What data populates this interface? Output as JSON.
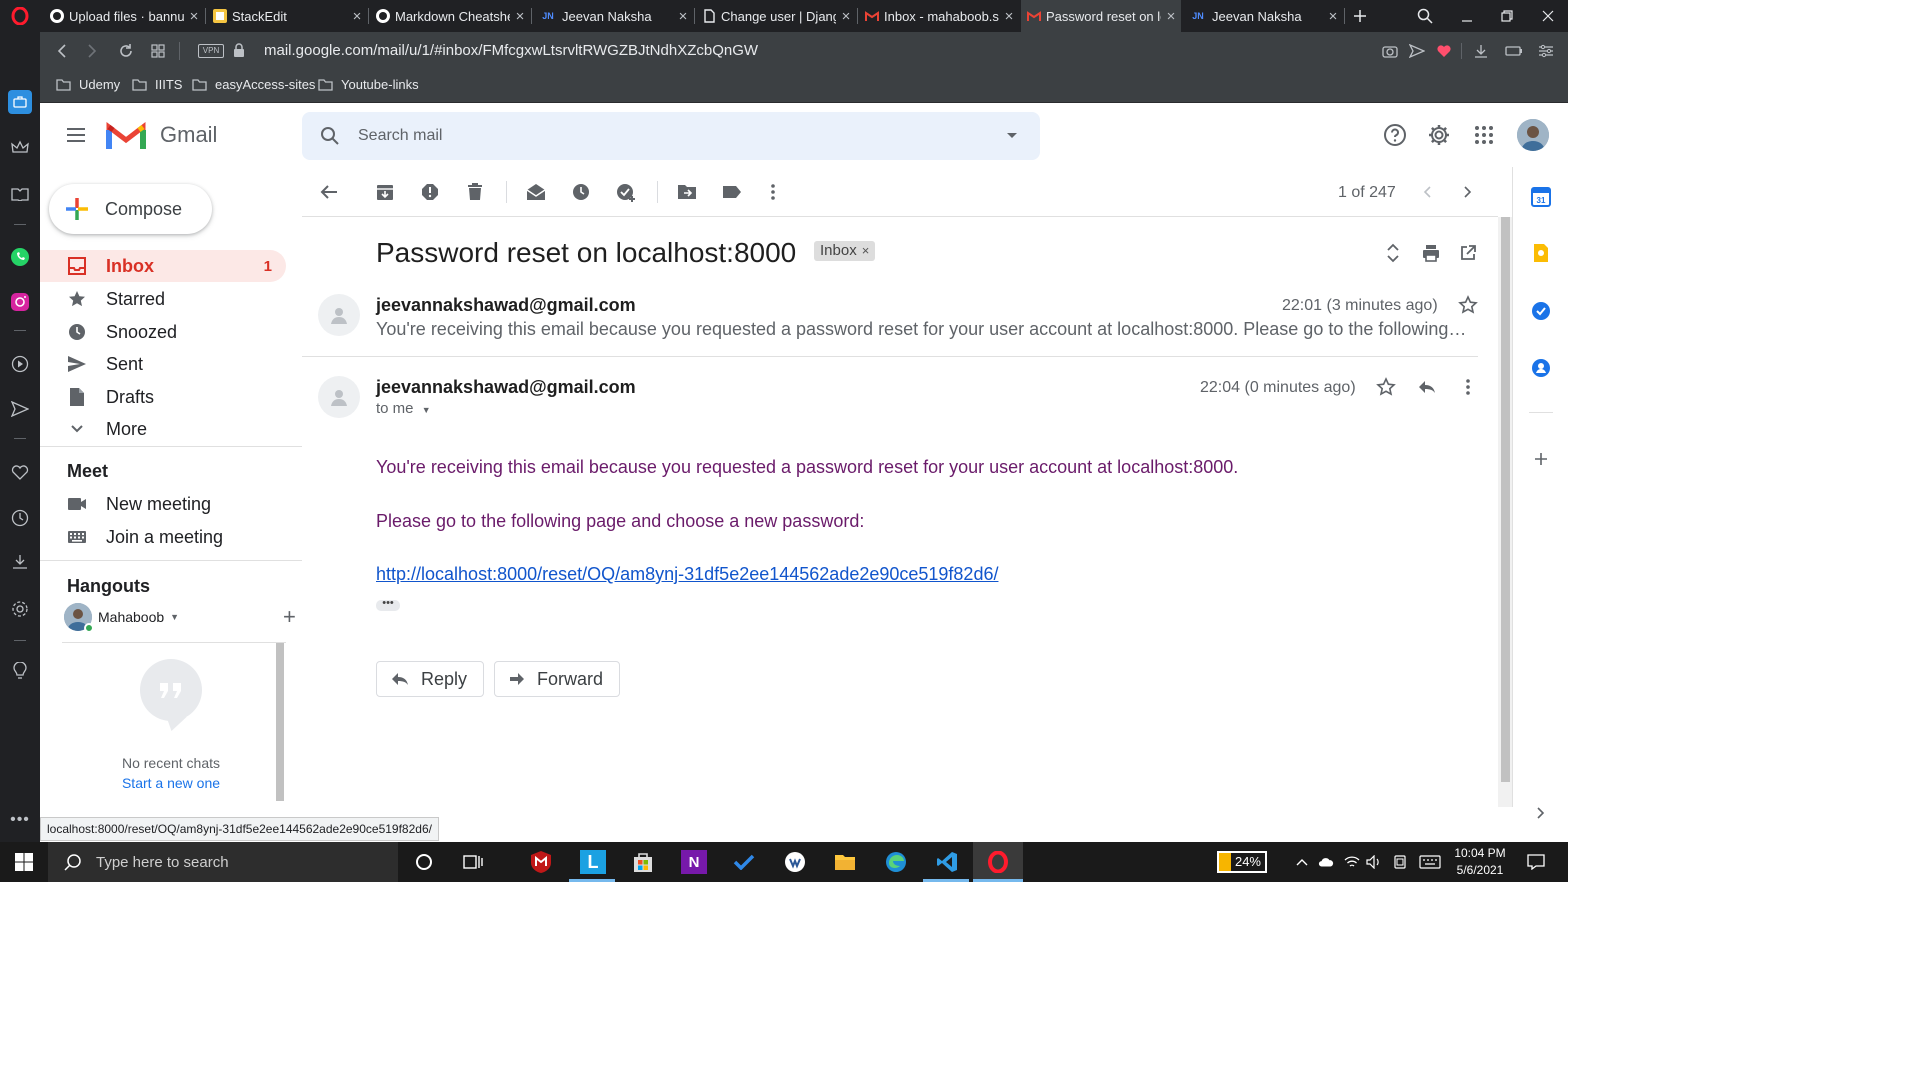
{
  "browser": {
    "tabs": [
      {
        "title": "Upload files · bannu",
        "icon": "github-icon",
        "active": false
      },
      {
        "title": "StackEdit",
        "icon": "stackedit-icon",
        "active": false
      },
      {
        "title": "Markdown Cheatsheet",
        "icon": "github-icon",
        "active": false
      },
      {
        "title": "Jeevan Naksha",
        "icon": "jn-icon",
        "active": false
      },
      {
        "title": "Change user | Django",
        "icon": "file-icon",
        "active": false
      },
      {
        "title": "Inbox - mahaboob.s",
        "icon": "gmail-icon",
        "active": false
      },
      {
        "title": "Password reset on lo",
        "icon": "gmail-icon",
        "active": true
      },
      {
        "title": "Jeevan Naksha",
        "icon": "jn-icon",
        "active": false
      }
    ],
    "url": "mail.google.com/mail/u/1/#inbox/FMfcgxwLtsrvltRWGZBJtNdhXZcbQnGW",
    "vpn_label": "VPN",
    "bookmarks": [
      "Udemy",
      "IIITS",
      "easyAccess-sites",
      "Youtube-links"
    ],
    "status_url": "localhost:8000/reset/OQ/am8ynj-31df5e2ee144562ade2e90ce519f82d6/"
  },
  "gmail": {
    "wordmark": "Gmail",
    "search_placeholder": "Search mail",
    "compose_label": "Compose",
    "nav": [
      {
        "label": "Inbox",
        "count": "1",
        "icon": "inbox-icon",
        "active": true
      },
      {
        "label": "Starred",
        "count": "",
        "icon": "star-icon",
        "active": false
      },
      {
        "label": "Snoozed",
        "count": "",
        "icon": "clock-icon",
        "active": false
      },
      {
        "label": "Sent",
        "count": "",
        "icon": "send-icon",
        "active": false
      },
      {
        "label": "Drafts",
        "count": "",
        "icon": "draft-icon",
        "active": false
      },
      {
        "label": "More",
        "count": "",
        "icon": "chevron-down-icon",
        "active": false
      }
    ],
    "meet": {
      "heading": "Meet",
      "items": [
        {
          "label": "New meeting",
          "icon": "video-icon"
        },
        {
          "label": "Join a meeting",
          "icon": "keyboard-icon"
        }
      ]
    },
    "hangouts": {
      "heading": "Hangouts",
      "user": "Mahaboob",
      "empty_text": "No recent chats",
      "start_text": "Start a new one"
    },
    "toolbar": {
      "page_count": "1 of 247"
    },
    "thread": {
      "subject": "Password reset on localhost:8000",
      "label_chip": "Inbox",
      "messages": [
        {
          "sender": "jeevannakshawad@gmail.com",
          "time": "22:01 (3 minutes ago)",
          "snippet": "You're receiving this email because you requested a password reset for your user account at localhost:8000. Please go to the following page and choose a new password:"
        },
        {
          "sender": "jeevannakshawad@gmail.com",
          "time": "22:04 (0 minutes ago)",
          "to": "to me",
          "body_line1": "You're receiving this email because you requested a password reset for your user account at localhost:8000.",
          "body_line2": "Please go to the following page and choose a new password:",
          "link": "http://localhost:8000/reset/OQ/am8ynj-31df5e2ee144562ade2e90ce519f82d6/",
          "ellipsis": "•••"
        }
      ],
      "reply_label": "Reply",
      "forward_label": "Forward"
    }
  },
  "taskbar": {
    "search_placeholder": "Type here to search",
    "battery": "24%",
    "time": "10:04 PM",
    "date": "5/6/2021"
  },
  "colors": {
    "gmail_red": "#d93025",
    "link_blue": "#1155cc",
    "body_purple": "#6a1b6a",
    "browser_dark": "#202124"
  }
}
